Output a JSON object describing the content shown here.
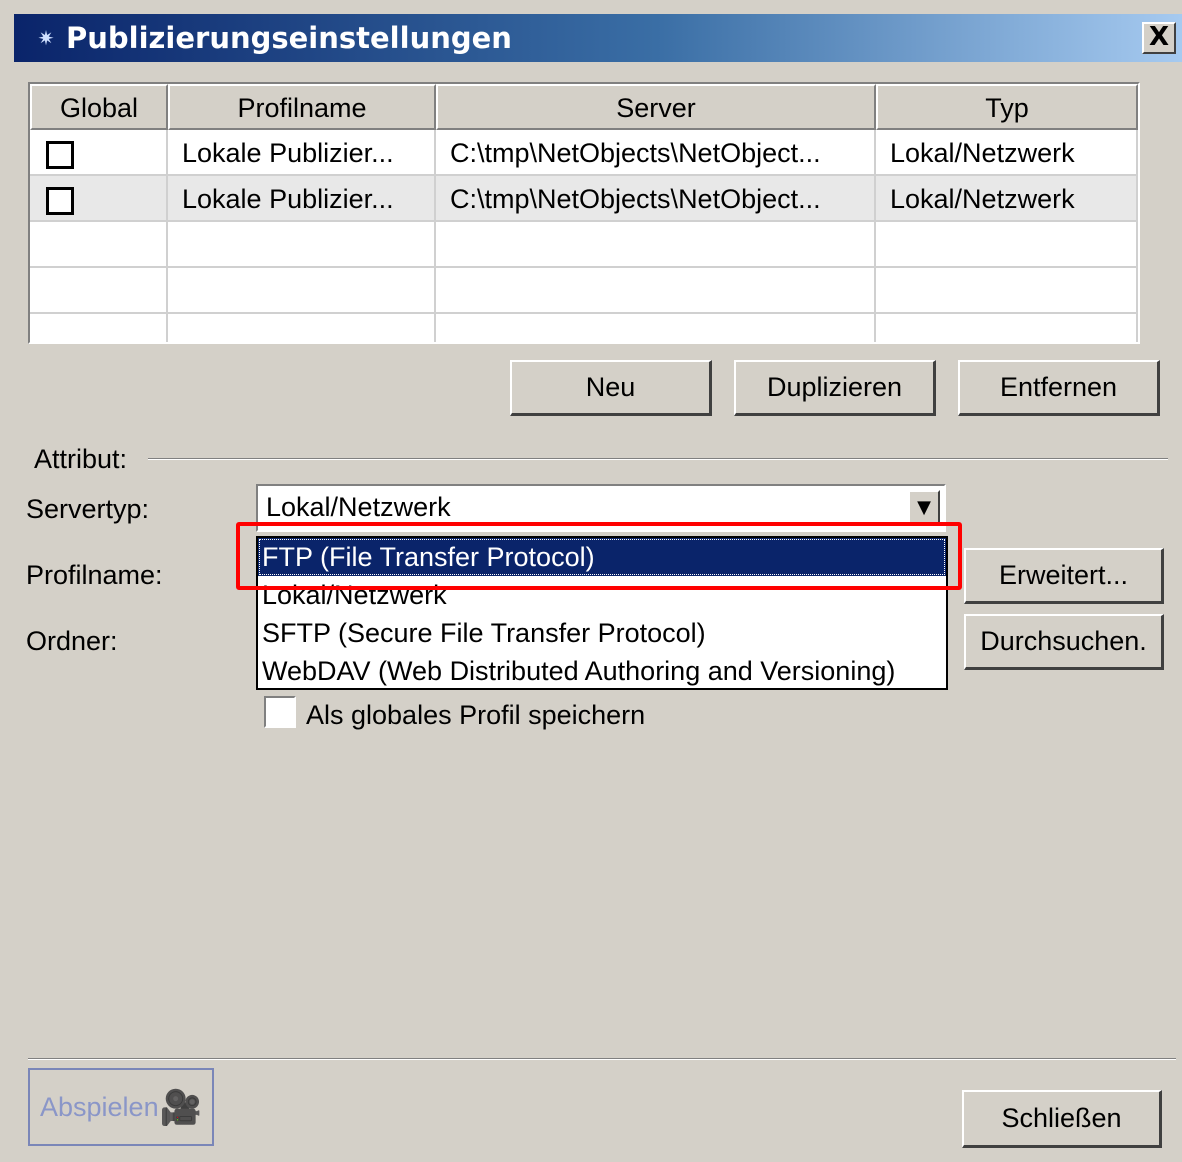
{
  "window": {
    "title": "Publizierungseinstellungen",
    "close_label": "X"
  },
  "table": {
    "columns": [
      "Global",
      "Profilname",
      "Server",
      "Typ"
    ],
    "rows": [
      {
        "global": false,
        "profile": "Lokale Publizier...",
        "server": "C:\\tmp\\NetObjects\\NetObject...",
        "type": "Lokal/Netzwerk"
      },
      {
        "global": false,
        "profile": "Lokale Publizier...",
        "server": "C:\\tmp\\NetObjects\\NetObject...",
        "type": "Lokal/Netzwerk"
      }
    ]
  },
  "buttons": {
    "new": "Neu",
    "duplicate": "Duplizieren",
    "remove": "Entfernen",
    "advanced": "Erweitert...",
    "browse": "Durchsuchen.",
    "close": "Schließen",
    "play": "Abspielen"
  },
  "attributes": {
    "section_label": "Attribut:",
    "servertype_label": "Servertyp:",
    "profilename_label": "Profilname:",
    "folder_label": "Ordner:",
    "servertype_value": "Lokal/Netzwerk",
    "global_profile_label": "Als globales Profil speichern"
  },
  "dropdown": {
    "options": [
      "FTP (File Transfer Protocol)",
      "Lokal/Netzwerk",
      "SFTP (Secure File Transfer Protocol)",
      "WebDAV (Web Distributed Authoring and Versioning)"
    ],
    "selected_index": 0
  },
  "colors": {
    "title_bar": "#0a246a",
    "selection": "#0a246a",
    "highlight_box": "#ff0000",
    "dialog_bg": "#d4d0c8"
  },
  "icons": {
    "title": "gear-icon",
    "play": "film-camera-icon",
    "combo_arrow": "chevron-down-icon"
  }
}
